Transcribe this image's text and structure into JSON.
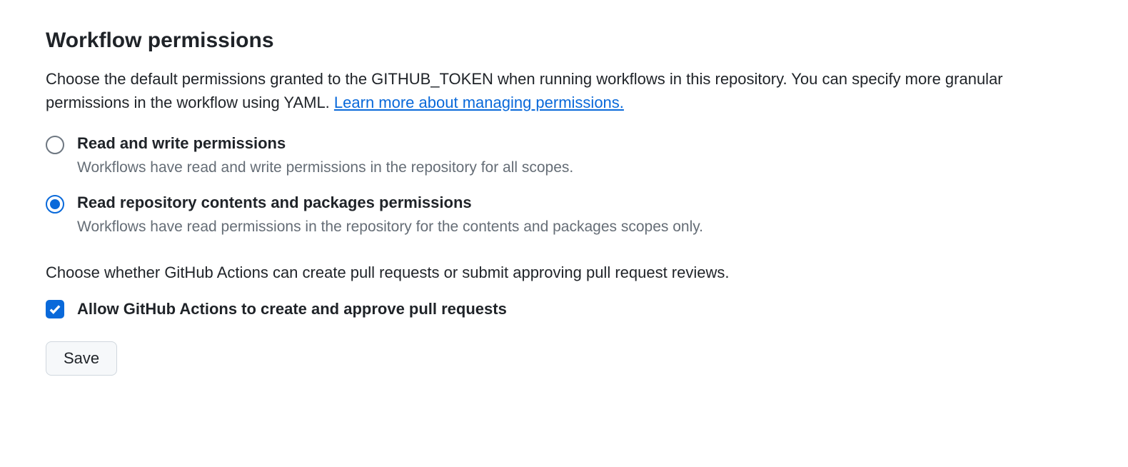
{
  "section": {
    "title": "Workflow permissions",
    "description_prefix": "Choose the default permissions granted to the GITHUB_TOKEN when running workflows in this repository. You can specify more granular permissions in the workflow using YAML. ",
    "link_text": "Learn more about managing permissions."
  },
  "radio_options": [
    {
      "label": "Read and write permissions",
      "description": "Workflows have read and write permissions in the repository for all scopes.",
      "selected": false
    },
    {
      "label": "Read repository contents and packages permissions",
      "description": "Workflows have read permissions in the repository for the contents and packages scopes only.",
      "selected": true
    }
  ],
  "second_description": "Choose whether GitHub Actions can create pull requests or submit approving pull request reviews.",
  "checkbox": {
    "label": "Allow GitHub Actions to create and approve pull requests",
    "checked": true
  },
  "save_button": "Save"
}
